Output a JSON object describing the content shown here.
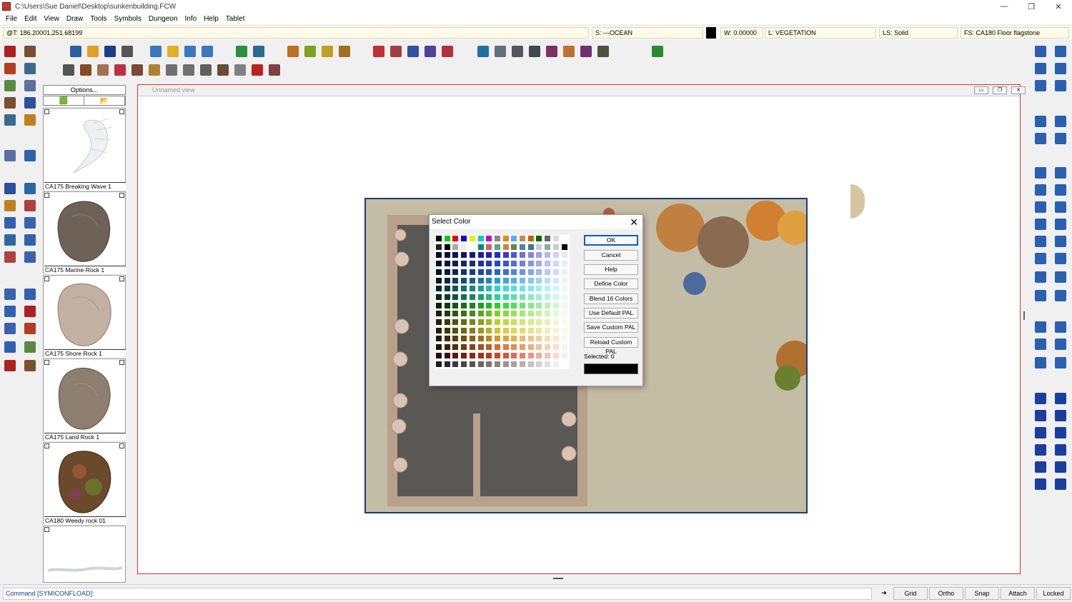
{
  "window": {
    "title": "C:\\Users\\Sue Daniel\\Desktop\\sunkenbuilding.FCW",
    "controls": [
      "—",
      "❐",
      "✕"
    ]
  },
  "menu": [
    "File",
    "Edit",
    "View",
    "Draw",
    "Tools",
    "Symbols",
    "Dungeon",
    "Info",
    "Help",
    "Tablet"
  ],
  "status": {
    "coords": "@T: 186.20001,251.68199",
    "sheet": "S: ---OCEAN",
    "width": "W: 0.00000",
    "layer": "L: VEGETATION",
    "line_style": "LS: Solid",
    "fill_style": "FS: CA180 Floor flagstone",
    "current_color": "#000000"
  },
  "symbols": {
    "options_label": "Options...",
    "items": [
      {
        "label": "CA175 Breaking Wave 1",
        "icon": "wave-symbol"
      },
      {
        "label": "CA175 Marine Rock 1",
        "icon": "rock-symbol"
      },
      {
        "label": "CA175 Shore Rock 1",
        "icon": "rock-symbol"
      },
      {
        "label": "CA175 Land Rock 1",
        "icon": "rock-symbol"
      },
      {
        "label": "CA180 Weedy rock 01",
        "icon": "weedy-rock-symbol"
      },
      {
        "label": "",
        "icon": "foam-symbol"
      }
    ]
  },
  "view": {
    "title": "Unnamed view",
    "controls": [
      "▭",
      "❐",
      "✕"
    ]
  },
  "dialog": {
    "title": "Select Color",
    "buttons": {
      "ok": "OK",
      "cancel": "Cancel",
      "help": "Help",
      "define": "Define Color",
      "blend": "Blend 16 Colors",
      "default_pal": "Use Default PAL",
      "save_pal": "Save Custom PAL",
      "reload_pal": "Reload Custom PAL"
    },
    "selected_label": "Selected: 0",
    "selected_color": "#000000"
  },
  "command": {
    "text": "Command [SYMICONFLOAD]:"
  },
  "bottom_buttons": [
    "Grid",
    "Ortho",
    "Snap",
    "Attach",
    "Locked"
  ],
  "colors": {
    "accent": "#1a3a7a",
    "view_border": "#e03030",
    "map_ground": "#c4bda5",
    "floor": "#5a5855",
    "wall": "#b8a08a"
  }
}
